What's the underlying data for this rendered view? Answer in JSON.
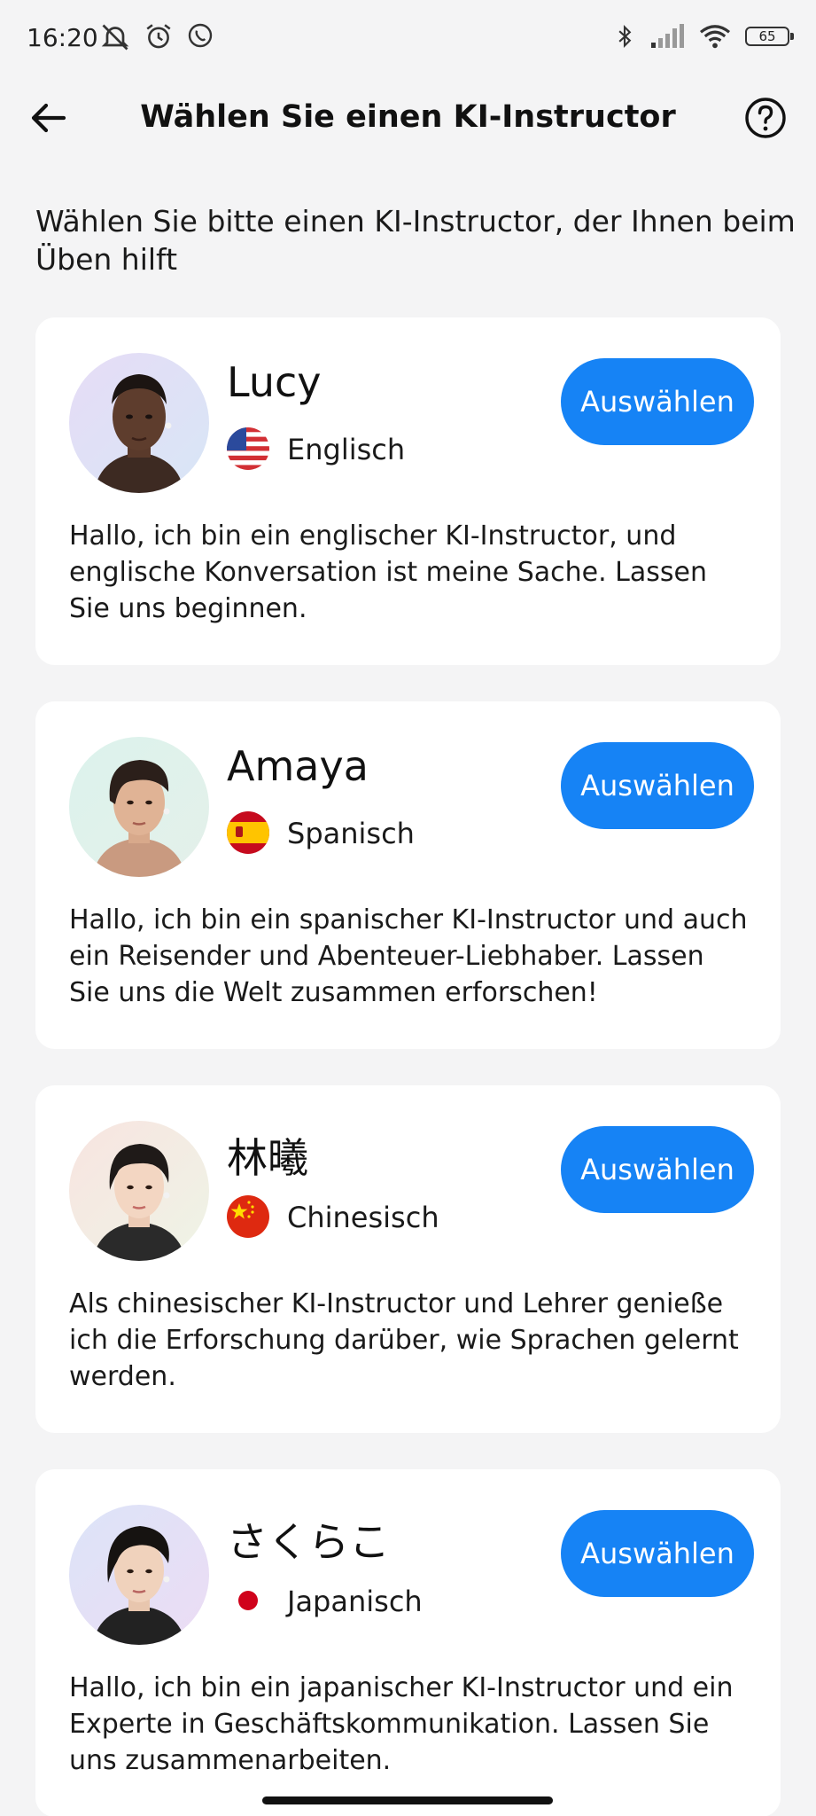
{
  "status_bar": {
    "time": "16:20",
    "battery": "65",
    "left_icons": [
      "muted-notifications-icon",
      "alarm-icon",
      "whatsapp-icon"
    ],
    "right_icons": [
      "bluetooth-icon",
      "signal-icon",
      "wifi-icon",
      "battery-icon"
    ]
  },
  "header": {
    "title": "Wählen Sie einen KI-Instructor",
    "back_icon": "back-arrow-icon",
    "help_icon": "help-icon"
  },
  "intro": "Wählen Sie bitte einen KI-Instructor, der Ihnen beim Üben hilft",
  "instructors": [
    {
      "name": "Lucy",
      "language": "Englisch",
      "flag": "us-flag-icon",
      "button": "Auswählen",
      "description": "Hallo, ich bin ein englischer KI-Instructor, und englische Konversation ist meine Sache. Lassen Sie uns beginnen."
    },
    {
      "name": "Amaya",
      "language": "Spanisch",
      "flag": "spain-flag-icon",
      "button": "Auswählen",
      "description": "Hallo, ich bin ein spanischer KI-Instructor und auch ein Reisender und Abenteuer-Liebhaber. Lassen Sie uns die Welt zusammen erforschen!"
    },
    {
      "name": "林曦",
      "language": "Chinesisch",
      "flag": "china-flag-icon",
      "button": "Auswählen",
      "description": "Als chinesischer KI-Instructor und Lehrer genieße ich die Erforschung darüber, wie Sprachen gelernt werden."
    },
    {
      "name": "さくらこ",
      "language": "Japanisch",
      "flag": "japan-flag-icon",
      "button": "Auswählen",
      "description": "Hallo, ich bin ein japanischer KI-Instructor und ein Experte in Geschäftskommunikation. Lassen Sie uns zusammenarbeiten."
    }
  ],
  "colors": {
    "accent": "#1683f5",
    "background": "#f4f4f5",
    "card": "#ffffff"
  }
}
